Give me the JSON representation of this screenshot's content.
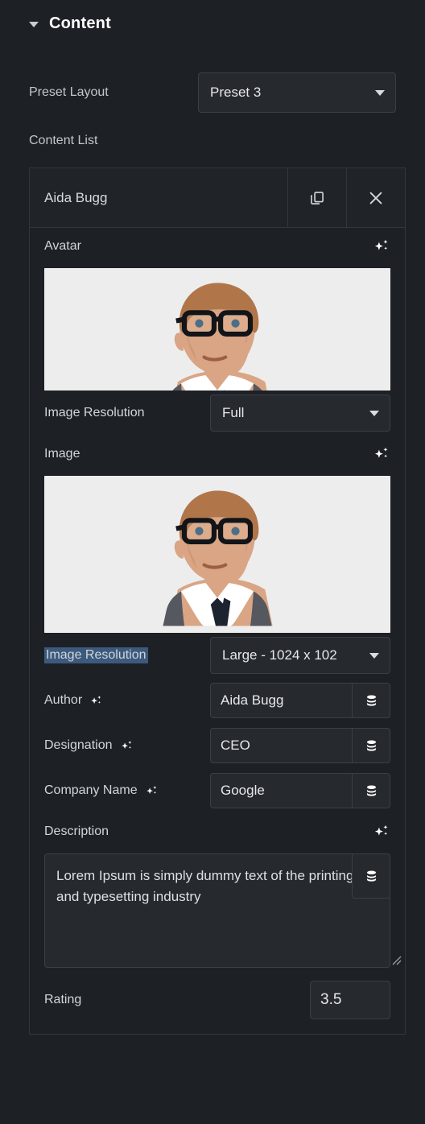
{
  "section": {
    "title": "Content",
    "caret_icon": "caret-down-icon",
    "expanded": true
  },
  "preset_layout": {
    "label": "Preset Layout",
    "value": "Preset 3",
    "dropdown_icon": "chevron-down-icon"
  },
  "content_list": {
    "label": "Content List",
    "item": {
      "title": "Aida Bugg",
      "duplicate_icon": "copy-icon",
      "remove_icon": "close-icon",
      "fields": {
        "avatar": {
          "label": "Avatar",
          "ai_icon": "sparkles-icon",
          "image_alt": "portrait of bearded man with black glasses, white shirt, dark tie and grey cardigan on light grey background"
        },
        "avatar_resolution": {
          "label": "Image Resolution",
          "value": "Full",
          "dropdown_icon": "chevron-down-icon"
        },
        "image": {
          "label": "Image",
          "ai_icon": "sparkles-icon",
          "image_alt": "portrait of bearded man with black glasses, white shirt, dark tie and grey cardigan on light grey background"
        },
        "image_resolution": {
          "label": "Image Resolution",
          "selected_text": true,
          "value": "Large - 1024 x 102",
          "dropdown_icon": "chevron-down-icon"
        },
        "author": {
          "label": "Author",
          "ai_icon": "sparkles-icon",
          "value": "Aida Bugg",
          "dynamic_icon": "database-icon"
        },
        "designation": {
          "label": "Designation",
          "ai_icon": "sparkles-icon",
          "value": "CEO",
          "dynamic_icon": "database-icon"
        },
        "company_name": {
          "label": "Company Name",
          "ai_icon": "sparkles-icon",
          "value": "Google",
          "dynamic_icon": "database-icon"
        },
        "description": {
          "label": "Description",
          "ai_icon": "sparkles-icon",
          "value": "Lorem Ipsum is simply dummy text of the printing and typesetting industry",
          "dynamic_icon": "database-icon",
          "resize_icon": "resize-handle-icon"
        },
        "rating": {
          "label": "Rating",
          "value": "3.5"
        }
      }
    }
  },
  "colors": {
    "background": "#1d2025",
    "panel_border": "#33373d",
    "input_background": "#26292e",
    "input_border": "#3c4046",
    "text_primary": "#e6e8ea",
    "text_label": "#c3c6cb",
    "selection_highlight": "#3c5a7d"
  }
}
